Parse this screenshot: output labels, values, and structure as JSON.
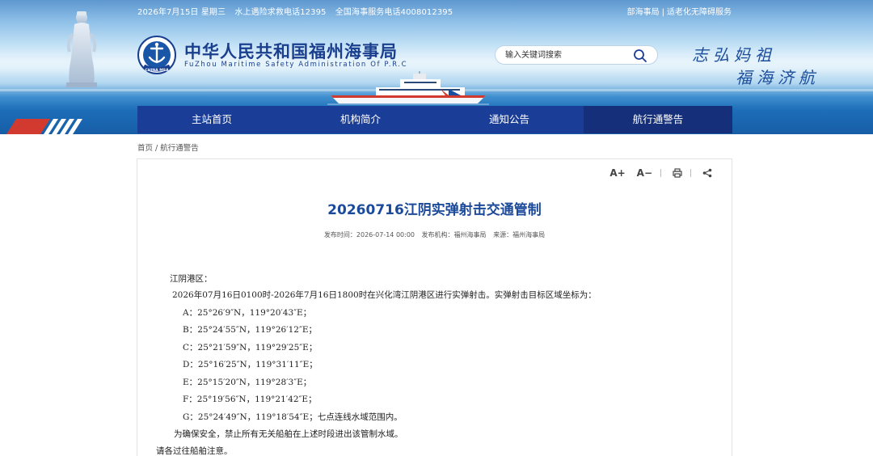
{
  "topbar": {
    "date": "2026年7月15日 星期三",
    "rescue_hotline": "水上遇险求救电话12395",
    "service_hotline": "全国海事服务电话4008012395",
    "link_ministry": "部海事局",
    "separator": "|",
    "link_accessibility": "适老化无障碍服务"
  },
  "logo": {
    "cn_name": "中华人民共和国福州海事局",
    "en_name": "FuZhou Maritime Safety Administration Of P.R.C",
    "emblem_text": "CHINA MSA"
  },
  "search": {
    "placeholder": "输入关键词搜索"
  },
  "slogan": {
    "line1": "志弘妈祖",
    "line2": "福海济航"
  },
  "nav": {
    "items": [
      "主站首页",
      "机构简介",
      "通知公告",
      "航行通警告"
    ],
    "active_index": 3
  },
  "breadcrumb": {
    "home": "首页",
    "separator": "/",
    "current": "航行通警告"
  },
  "article": {
    "title": "20260716江阴实弹射击交通管制",
    "meta": {
      "publish_time": "发布时间：2026-07-14 00:00",
      "publish_org": "发布机构：福州海事局",
      "source": "来源：福州海事局"
    },
    "area_heading": "江阴港区：",
    "intro": "2026年07月16日0100时-2026年7月16日1800时在兴化湾江阴港区进行实弹射击。实弹射击目标区域坐标为：",
    "points": [
      "A：25°26′9″N，119°20′43″E；",
      "B：25°24′55″N，119°26′12″E；",
      "C：25°21′59″N，119°29′25″E；",
      "D：25°16′25″N，119°31′11″E；",
      "E：25°15′20″N，119°28′3″E；",
      "F：25°19′56″N，119°21′42″E；",
      "G：25°24′49″N，119°18′54″E；七点连线水域范围内。"
    ],
    "safety_notice": "为确保安全，禁止所有无关船舶在上述时段进出该管制水域。",
    "closing": "请各过往船舶注意。"
  },
  "tools": {
    "font_increase": "A+",
    "font_decrease": "A−"
  },
  "colors": {
    "nav_bg": "#1a3d97",
    "nav_active": "#152f7a",
    "title": "#1b4a9a",
    "logo": "#1a3f8f"
  }
}
